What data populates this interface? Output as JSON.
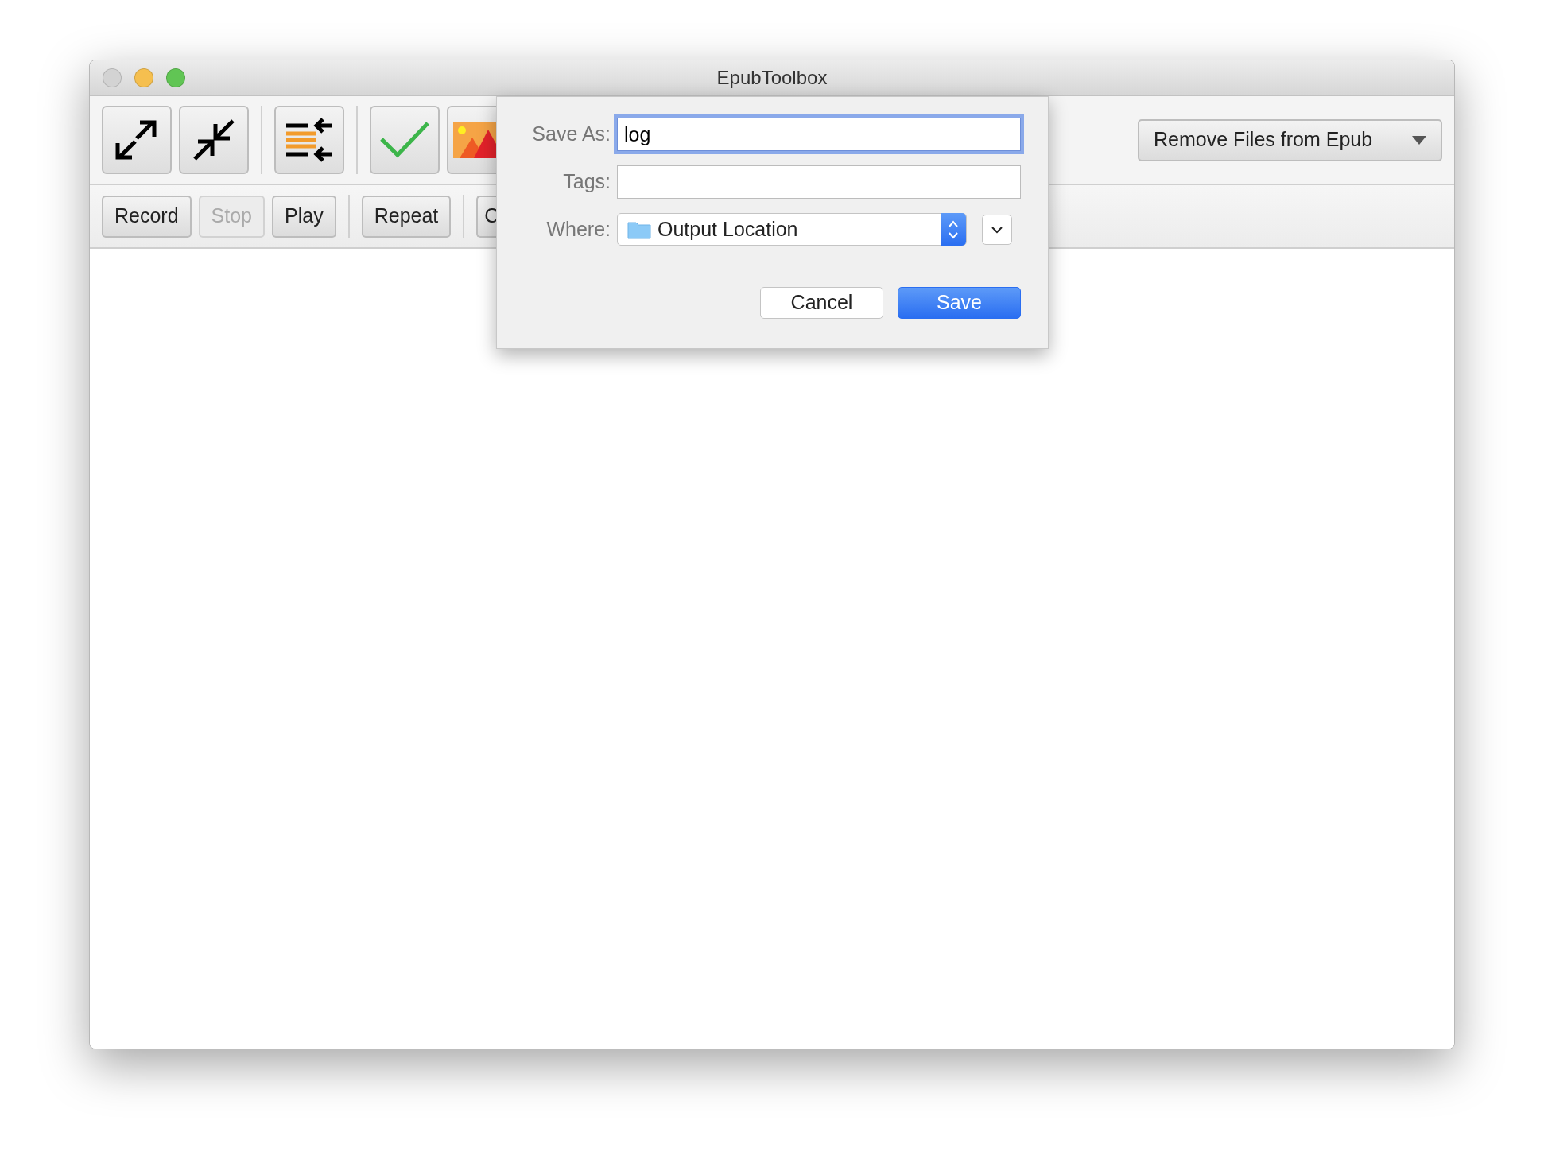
{
  "window": {
    "title": "EpubToolbox"
  },
  "action_dropdown": {
    "value": "Remove Files from Epub"
  },
  "buttons": [
    {
      "label": "Record",
      "disabled": false,
      "separator_after": false
    },
    {
      "label": "Stop",
      "disabled": true,
      "separator_after": false
    },
    {
      "label": "Play",
      "disabled": false,
      "separator_after": true
    },
    {
      "label": "Repeat",
      "disabled": false,
      "separator_after": true
    },
    {
      "label": "C",
      "disabled": false,
      "separator_after": false
    }
  ],
  "save_dialog": {
    "save_as": {
      "label": "Save As:",
      "value": "log",
      "focused": true
    },
    "tags": {
      "label": "Tags:"
    },
    "where": {
      "label": "Where:",
      "value": "Output Location"
    },
    "buttons": [
      {
        "label": "Cancel",
        "kind": "default"
      },
      {
        "label": "Save",
        "kind": "primary"
      }
    ]
  }
}
